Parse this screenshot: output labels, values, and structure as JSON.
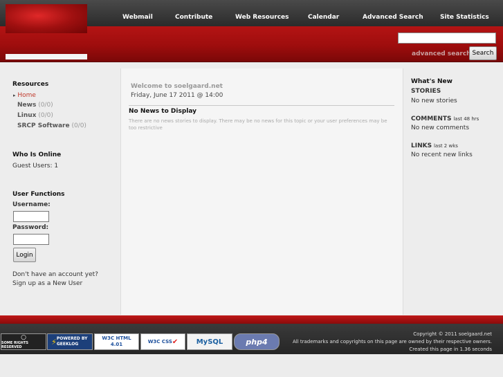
{
  "nav": [
    "Webmail",
    "Contribute",
    "Web Resources",
    "Calendar",
    "Advanced Search",
    "Site Statistics"
  ],
  "search": {
    "placeholder": "",
    "advanced_label": "advanced search",
    "button_label": "Search"
  },
  "left": {
    "resources_title": "Resources",
    "resources": [
      {
        "label": "Home",
        "count": ""
      },
      {
        "label": "News",
        "count": "(0/0)"
      },
      {
        "label": "Linux",
        "count": "(0/0)"
      },
      {
        "label": "SRCP Software",
        "count": "(0/0)"
      }
    ],
    "who_title": "Who Is Online",
    "guest_users": "Guest Users: 1",
    "uf_title": "User Functions",
    "username_label": "Username:",
    "password_label": "Password:",
    "login_label": "Login",
    "no_account": "Don't have an account yet?",
    "signup_prefix": "Sign up as a ",
    "new_user_link": "New User"
  },
  "center": {
    "welcome": "Welcome to soelgaard.net",
    "date": "Friday, June 17 2011 @ 14:00",
    "no_news_title": "No News to Display",
    "no_news_text_1": "There are no news stories to display. There may be no news for this topic or your user preferences may be",
    "no_news_text_2": "too restrictive"
  },
  "right": {
    "whats_new": "What's New",
    "stories_title": "STORIES",
    "stories_text": "No new stories",
    "comments_title": "COMMENTS",
    "comments_period": "last 48 hrs",
    "comments_text": "No new comments",
    "links_title": "LINKS",
    "links_period": "last 2 wks",
    "links_text": "No recent new links"
  },
  "footer": {
    "badges": [
      "SOME RIGHTS RESERVED",
      "POWERED BY GEEKLOG",
      "W3C HTML 4.01",
      "W3C CSS",
      "MySQL",
      "php4"
    ],
    "copyright": "Copyright © 2011 soelgaard.net",
    "trademarks": "All trademarks and copyrights on this page are owned by their respective owners.",
    "created": "Created this page in 1.36 seconds"
  },
  "colors": {
    "banner_red": "#a51010",
    "nav_bg": "#333333",
    "link_red": "#c0392b"
  }
}
